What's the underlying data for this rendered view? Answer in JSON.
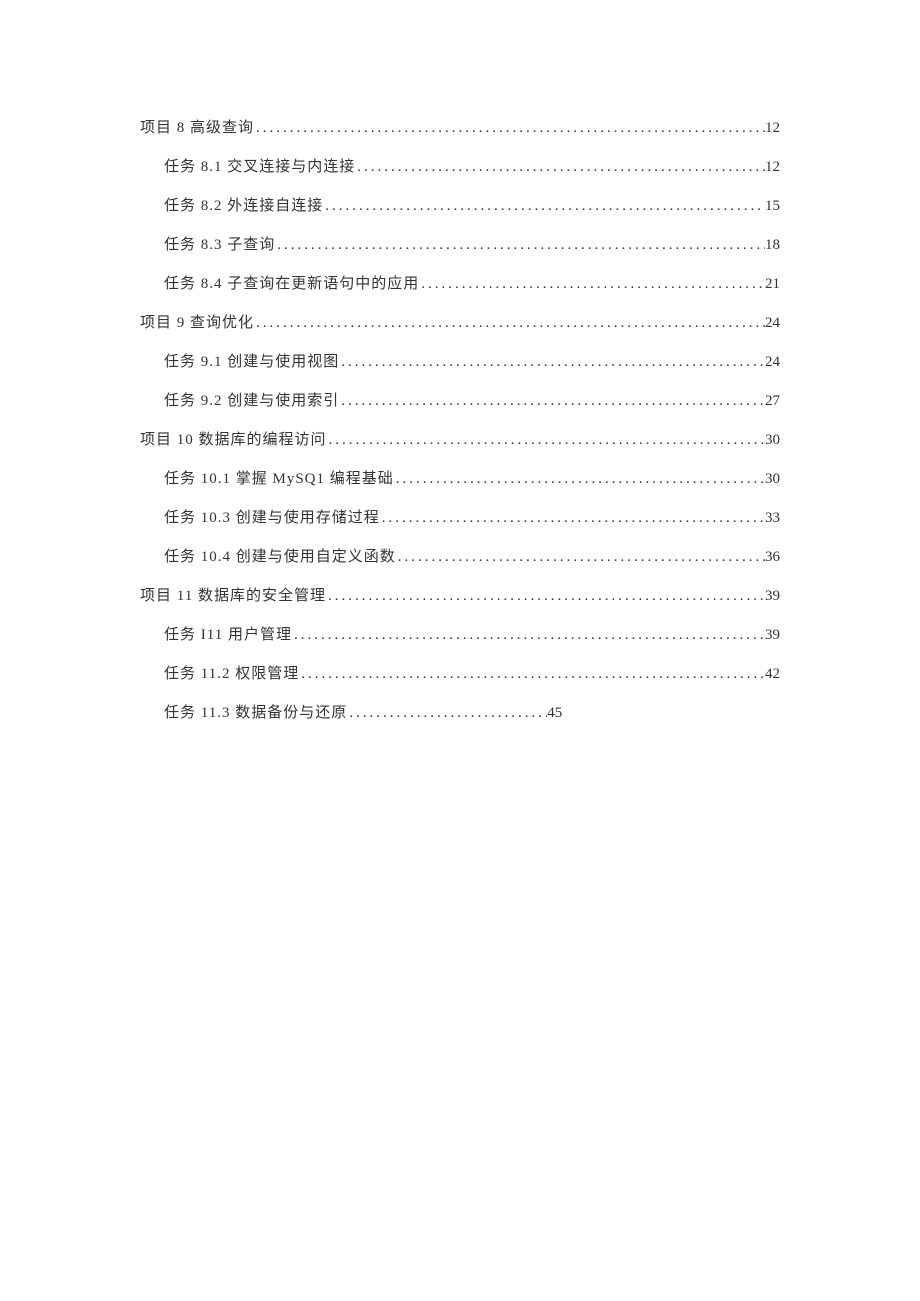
{
  "toc": [
    {
      "level": 1,
      "title": "项目 8 高级查询",
      "page": "12",
      "short": false
    },
    {
      "level": 2,
      "title": "任务 8.1 交叉连接与内连接",
      "page": "12",
      "short": false
    },
    {
      "level": 2,
      "title": "任务 8.2 外连接自连接",
      "page": "15",
      "short": false
    },
    {
      "level": 2,
      "title": "任务 8.3 子查询",
      "page": "18",
      "short": false
    },
    {
      "level": 2,
      "title": "任务 8.4 子查询在更新语句中的应用",
      "page": "21",
      "short": false
    },
    {
      "level": 1,
      "title": "项目 9 查询优化",
      "page": "24",
      "short": false
    },
    {
      "level": 2,
      "title": "任务 9.1 创建与使用视图",
      "page": "24",
      "short": false
    },
    {
      "level": 2,
      "title": "任务 9.2 创建与使用索引",
      "page": "27",
      "short": false
    },
    {
      "level": 1,
      "title": "项目 10 数据库的编程访问",
      "page": "30",
      "short": false
    },
    {
      "level": 2,
      "title": "任务 10.1 掌握 MySQ1 编程基础",
      "page": "30",
      "short": false
    },
    {
      "level": 2,
      "title": "任务 10.3 创建与使用存储过程",
      "page": "33",
      "short": false
    },
    {
      "level": 2,
      "title": "任务 10.4 创建与使用自定义函数",
      "page": "36",
      "short": false
    },
    {
      "level": 1,
      "title": "项目 11 数据库的安全管理",
      "page": "39",
      "short": false
    },
    {
      "level": 2,
      "title": "任务 I11 用户管理",
      "page": "39",
      "short": false
    },
    {
      "level": 2,
      "title": "任务 11.2 权限管理",
      "page": "42",
      "short": false
    },
    {
      "level": 2,
      "title": "任务 11.3 数据备份与还原",
      "page": "45",
      "short": true
    }
  ]
}
